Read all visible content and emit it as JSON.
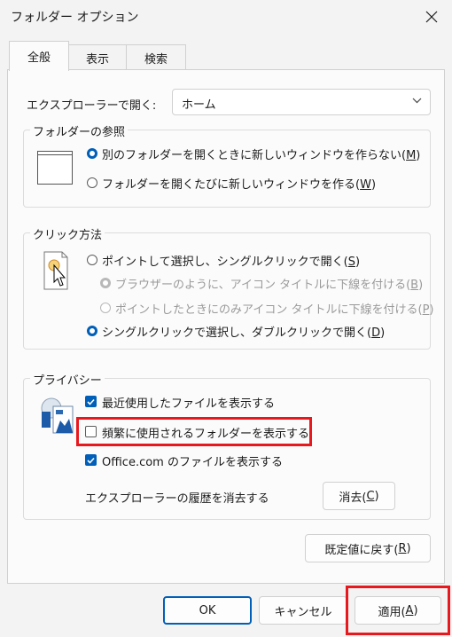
{
  "window": {
    "title": "フォルダー オプション"
  },
  "tabs": [
    {
      "label": "全般"
    },
    {
      "label": "表示"
    },
    {
      "label": "検索"
    }
  ],
  "open_explorer": {
    "label": "エクスプローラーで開く:",
    "value": "ホーム"
  },
  "browse_folders": {
    "title": "フォルダーの参照",
    "options": [
      {
        "text": "別のフォルダーを開くときに新しいウィンドウを作らない(",
        "key": "M",
        "suffix": ")"
      },
      {
        "text": "フォルダーを開くたびに新しいウィンドウを作る(",
        "key": "W",
        "suffix": ")"
      }
    ]
  },
  "click_method": {
    "title": "クリック方法",
    "options": [
      {
        "text": "ポイントして選択し、シングルクリックで開く(",
        "key": "S",
        "suffix": ")"
      },
      {
        "text": "ブラウザーのように、アイコン タイトルに下線を付ける(",
        "key": "B",
        "suffix": ")"
      },
      {
        "text": "ポイントしたときにのみアイコン タイトルに下線を付ける(",
        "key": "P",
        "suffix": ")"
      },
      {
        "text": "シングルクリックで選択し、ダブルクリックで開く(",
        "key": "D",
        "suffix": ")"
      }
    ]
  },
  "privacy": {
    "title": "プライバシー",
    "checks": [
      {
        "text": "最近使用したファイルを表示する"
      },
      {
        "text": "頻繁に使用されるフォルダーを表示する"
      },
      {
        "text": "Office.com のファイルを表示する"
      }
    ],
    "history_label": "エクスプローラーの履歴を消去する",
    "clear_button": {
      "text": "消去(",
      "key": "C",
      "suffix": ")"
    }
  },
  "restore_button": {
    "text": "既定値に戻す(",
    "key": "R",
    "suffix": ")"
  },
  "footer": {
    "ok": "OK",
    "cancel": "キャンセル",
    "apply": {
      "text": "適用(",
      "key": "A",
      "suffix": ")"
    }
  },
  "colors": {
    "accent": "#005fb8",
    "highlight": "#e8191e",
    "background": "#f3f3f3",
    "panel": "#fbfbfb"
  }
}
